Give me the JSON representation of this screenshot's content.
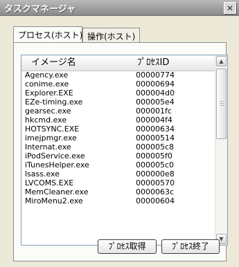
{
  "window": {
    "title": "タスクマネージャ",
    "close_glyph": "✕"
  },
  "tabs": [
    {
      "label": "プロセス(ホスト)",
      "active": true
    },
    {
      "label": "操作(ホスト)",
      "active": false
    }
  ],
  "listview": {
    "columns": [
      "イメージ名",
      "ﾌﾟﾛｾｽID"
    ],
    "rows": [
      {
        "name": "Agency.exe",
        "pid": "00000774"
      },
      {
        "name": "conime.exe",
        "pid": "00000694"
      },
      {
        "name": "Explorer.EXE",
        "pid": "000004d0"
      },
      {
        "name": "EZe-timing.exe",
        "pid": "000005e4"
      },
      {
        "name": "gearsec.exe",
        "pid": "000001fc"
      },
      {
        "name": "hkcmd.exe",
        "pid": "000004f4"
      },
      {
        "name": "HOTSYNC.EXE",
        "pid": "00000634"
      },
      {
        "name": "imejpmgr.exe",
        "pid": "00000514"
      },
      {
        "name": "Internat.exe",
        "pid": "000005c8"
      },
      {
        "name": "iPodService.exe",
        "pid": "000005f0"
      },
      {
        "name": "iTunesHelper.exe",
        "pid": "000005c0"
      },
      {
        "name": "lsass.exe",
        "pid": "000000e8"
      },
      {
        "name": "LVCOMS.EXE",
        "pid": "00000570"
      },
      {
        "name": "MemCleaner.exe",
        "pid": "0000063c"
      },
      {
        "name": "MiroMenu2.exe",
        "pid": "00000604"
      }
    ]
  },
  "buttons": {
    "get_process": "ﾌﾟﾛｾｽ取得",
    "end_process": "ﾌﾟﾛｾｽ終了"
  },
  "icons": {
    "scroll_up": "▲",
    "scroll_down": "▼"
  }
}
